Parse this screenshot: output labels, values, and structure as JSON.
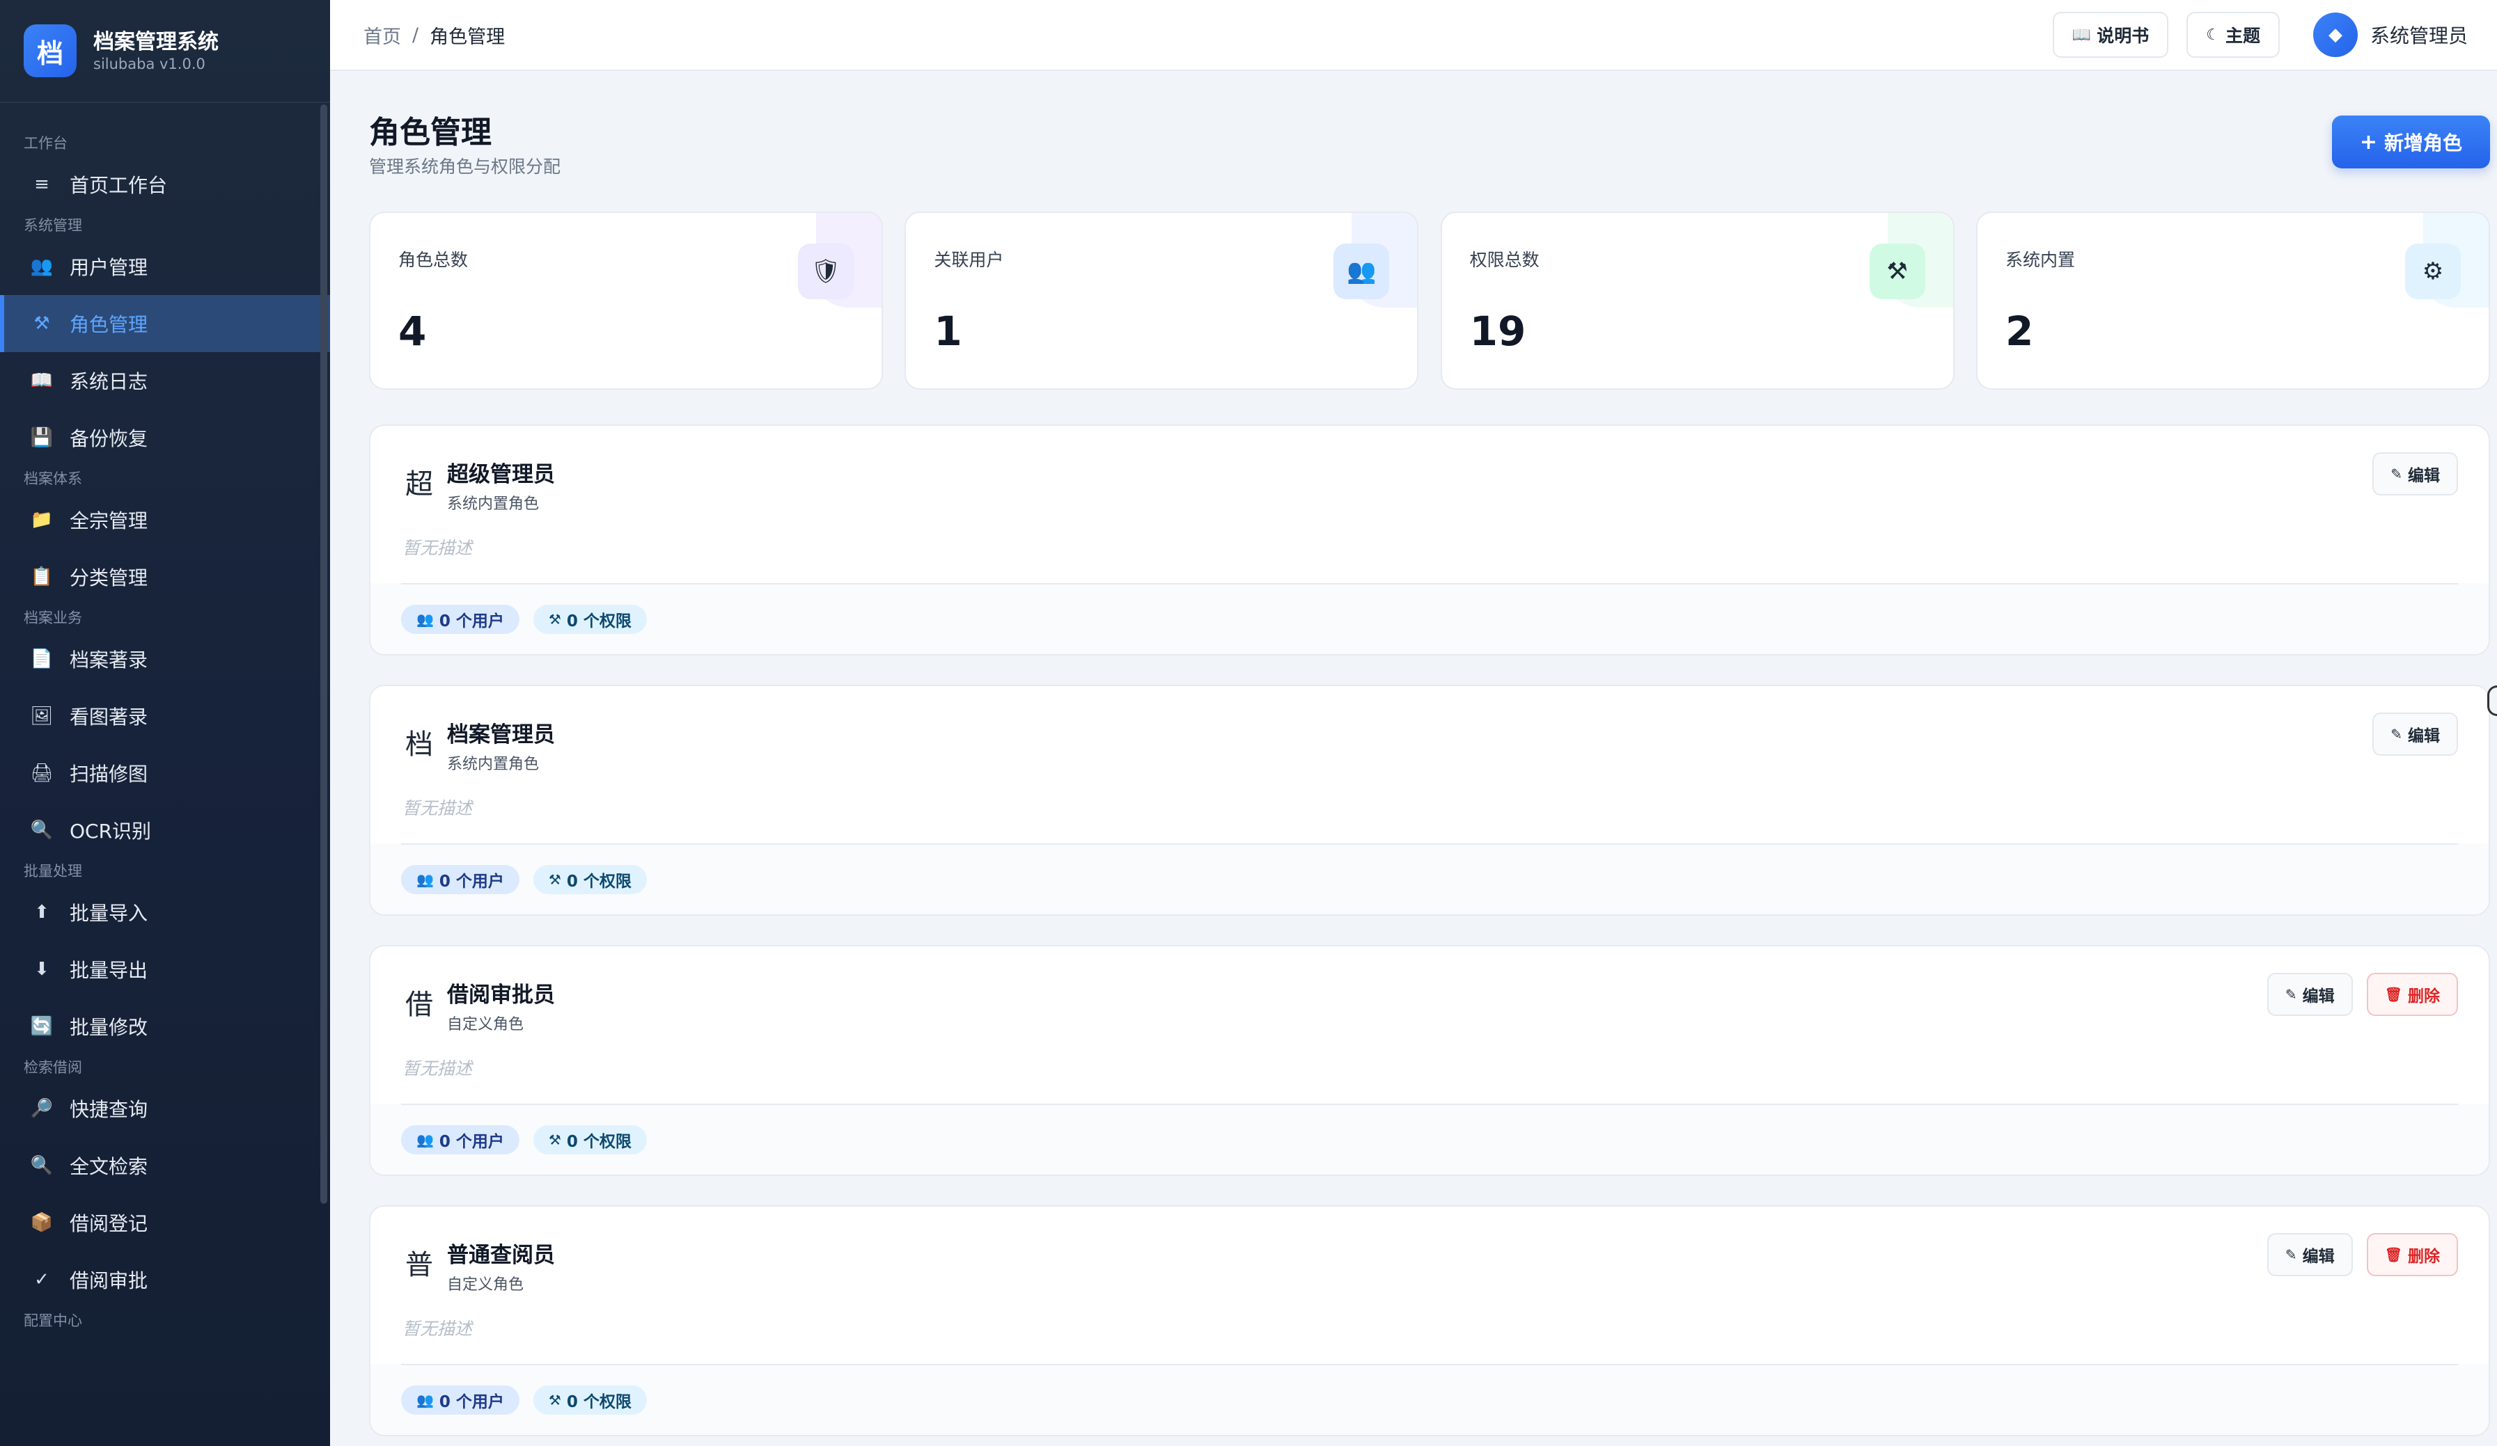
{
  "brand": {
    "logo_char": "档",
    "title": "档案管理系统",
    "subtitle": "silubaba v1.0.0"
  },
  "sidebar": {
    "groups": [
      {
        "label": "工作台",
        "items": [
          {
            "label": "首页工作台",
            "icon": "≡"
          }
        ]
      },
      {
        "label": "系统管理",
        "items": [
          {
            "label": "用户管理",
            "icon": "👥"
          },
          {
            "label": "角色管理",
            "icon": "⚒"
          },
          {
            "label": "系统日志",
            "icon": "📖"
          },
          {
            "label": "备份恢复",
            "icon": "💾"
          }
        ]
      },
      {
        "label": "档案体系",
        "items": [
          {
            "label": "全宗管理",
            "icon": "📁"
          },
          {
            "label": "分类管理",
            "icon": "📋"
          }
        ]
      },
      {
        "label": "档案业务",
        "items": [
          {
            "label": "档案著录",
            "icon": "📄"
          },
          {
            "label": "看图著录",
            "icon": "🖼"
          },
          {
            "label": "扫描修图",
            "icon": "🖨"
          },
          {
            "label": "OCR识别",
            "icon": "🔍"
          }
        ]
      },
      {
        "label": "批量处理",
        "items": [
          {
            "label": "批量导入",
            "icon": "⬆"
          },
          {
            "label": "批量导出",
            "icon": "⬇"
          },
          {
            "label": "批量修改",
            "icon": "🔄"
          }
        ]
      },
      {
        "label": "检索借阅",
        "items": [
          {
            "label": "快捷查询",
            "icon": "🔎"
          },
          {
            "label": "全文检索",
            "icon": "🔍"
          },
          {
            "label": "借阅登记",
            "icon": "📦"
          },
          {
            "label": "借阅审批",
            "icon": "✓"
          }
        ]
      },
      {
        "label": "配置中心",
        "items": []
      }
    ],
    "active": "角色管理"
  },
  "topbar": {
    "breadcrumb_home": "首页",
    "breadcrumb_sep": "/",
    "breadcrumb_current": "角色管理",
    "manual_icon": "📖",
    "manual_label": "说明书",
    "theme_icon": "☾",
    "theme_label": "主题",
    "user_avatar_icon": "◆",
    "user_name": "系统管理员"
  },
  "page": {
    "title": "角色管理",
    "subtitle": "管理系统角色与权限分配",
    "add_icon": "+",
    "add_label": "新增角色"
  },
  "stats": [
    {
      "label": "角色总数",
      "value": "4",
      "icon": "🛡",
      "icon_bg": "#ede9fe",
      "corner": "#f3efff"
    },
    {
      "label": "关联用户",
      "value": "1",
      "icon": "👥",
      "icon_bg": "#dbeafe",
      "corner": "#eef3ff"
    },
    {
      "label": "权限总数",
      "value": "19",
      "icon": "⚒",
      "icon_bg": "#d1fae5",
      "corner": "#ecfbf3"
    },
    {
      "label": "系统内置",
      "value": "2",
      "icon": "⚙",
      "icon_bg": "#e0f2fe",
      "corner": "#eef8ff"
    }
  ],
  "roles": [
    {
      "initial": "超",
      "name": "超级管理员",
      "type": "系统内置角色",
      "desc": "暂无描述",
      "users": "0 个用户",
      "perms": "0 个权限",
      "deletable": false
    },
    {
      "initial": "档",
      "name": "档案管理员",
      "type": "系统内置角色",
      "desc": "暂无描述",
      "users": "0 个用户",
      "perms": "0 个权限",
      "deletable": false
    },
    {
      "initial": "借",
      "name": "借阅审批员",
      "type": "自定义角色",
      "desc": "暂无描述",
      "users": "0 个用户",
      "perms": "0 个权限",
      "deletable": true
    },
    {
      "initial": "普",
      "name": "普通查阅员",
      "type": "自定义角色",
      "desc": "暂无描述",
      "users": "0 个用户",
      "perms": "0 个权限",
      "deletable": true
    }
  ],
  "role_actions": {
    "edit_icon": "✎",
    "edit_label": "编辑",
    "delete_icon": "🗑",
    "delete_label": "删除"
  },
  "chip_icons": {
    "users": "👥",
    "perms": "⚒"
  }
}
